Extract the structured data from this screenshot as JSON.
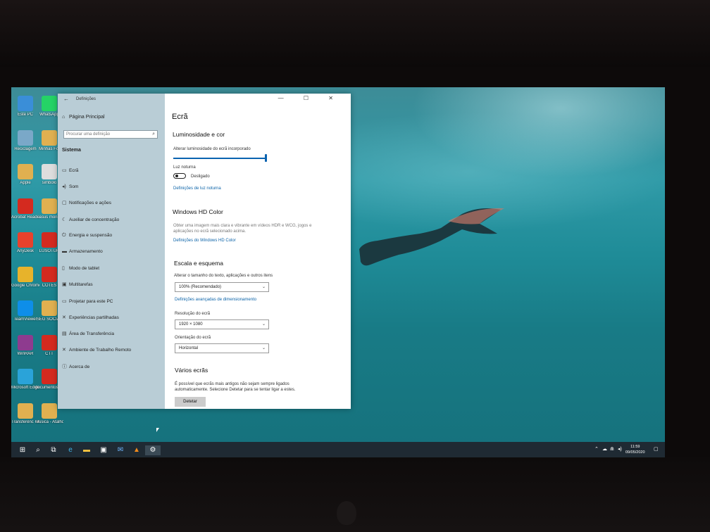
{
  "desktop": {
    "icons": [
      {
        "label": "Este PC",
        "color": "#3a8ed8"
      },
      {
        "label": "WhatsApp",
        "color": "#25d366"
      },
      {
        "label": "Reciclagem",
        "color": "#7aa8c8"
      },
      {
        "label": "Minhas Fot",
        "color": "#e0b050"
      },
      {
        "label": "Apple",
        "color": "#e0b050"
      },
      {
        "label": "simbolo",
        "color": "#ddd"
      },
      {
        "label": "Acrobat Reader DC",
        "color": "#d42a1f"
      },
      {
        "label": "asus monit",
        "color": "#e0b050"
      },
      {
        "label": "AnyDesk",
        "color": "#e8412c"
      },
      {
        "label": "LUSOTUR",
        "color": "#d42a1f"
      },
      {
        "label": "Google Chrome",
        "color": "#e7b32b"
      },
      {
        "label": "COTES",
        "color": "#d42a1f"
      },
      {
        "label": "TeamViewer",
        "color": "#0e8ee9"
      },
      {
        "label": "SEG SOCIAL",
        "color": "#e0b050"
      },
      {
        "label": "WinRAR",
        "color": "#8e3b8f"
      },
      {
        "label": "CTT",
        "color": "#d42a1f"
      },
      {
        "label": "Microsoft Edge",
        "color": "#2aa3d9"
      },
      {
        "label": "documentos carros",
        "color": "#d42a1f"
      },
      {
        "label": "Transferênc - Atalho",
        "color": "#e0b050"
      },
      {
        "label": "Musica - Atalho",
        "color": "#e0b050"
      }
    ]
  },
  "window": {
    "title": "Definições",
    "controls": "— ☐ ✕",
    "sidebar": {
      "home": "Página Principal",
      "search_placeholder": "Procurar uma definição",
      "heading": "Sistema",
      "items": [
        {
          "label": "Ecrã",
          "icon": "display-icon",
          "glyph": "▭"
        },
        {
          "label": "Som",
          "icon": "sound-icon",
          "glyph": "◂)"
        },
        {
          "label": "Notificações e ações",
          "icon": "notifications-icon",
          "glyph": "▢"
        },
        {
          "label": "Auxiliar de concentração",
          "icon": "focus-assist-icon",
          "glyph": "☾"
        },
        {
          "label": "Energia e suspensão",
          "icon": "power-icon",
          "glyph": "⏻"
        },
        {
          "label": "Armazenamento",
          "icon": "storage-icon",
          "glyph": "▬"
        },
        {
          "label": "Modo de tablet",
          "icon": "tablet-icon",
          "glyph": "▯"
        },
        {
          "label": "Multitarefas",
          "icon": "multitasking-icon",
          "glyph": "▣"
        },
        {
          "label": "Projetar para este PC",
          "icon": "project-icon",
          "glyph": "▭"
        },
        {
          "label": "Experiências partilhadas",
          "icon": "shared-experiences-icon",
          "glyph": "✕"
        },
        {
          "label": "Área de Transferência",
          "icon": "clipboard-icon",
          "glyph": "▤"
        },
        {
          "label": "Ambiente de Trabalho Remoto",
          "icon": "remote-desktop-icon",
          "glyph": "✕"
        },
        {
          "label": "Acerca de",
          "icon": "about-icon",
          "glyph": "ⓘ"
        }
      ]
    },
    "content": {
      "page_title": "Ecrã",
      "brightness_heading": "Luminosidade e cor",
      "brightness_label": "Alterar luminosidade do ecrã incorporado",
      "brightness_level": 1.0,
      "night_light_label": "Luz noturna",
      "night_light_state": "Desligado",
      "night_light_link": "Definições de luz noturna",
      "hd_heading": "Windows HD Color",
      "hd_desc_1": "Obter uma imagem mais clara e vibrante em vídeos HDR e WCG, jogos e",
      "hd_desc_2": "aplicações no ecrã selecionado acima.",
      "hd_link": "Definições do Windows HD Color",
      "scale_heading": "Escala e esquema",
      "scale_label": "Alterar o tamanho do texto, aplicações e outros itens",
      "scale_value": "100% (Recomendado)",
      "scale_link": "Definições avançadas de dimensionamento",
      "resolution_label": "Resolução do ecrã",
      "resolution_value": "1920 × 1080",
      "orientation_label": "Orientação do ecrã",
      "orientation_value": "Horizontal",
      "multi_heading": "Vários ecrãs",
      "multi_desc_1": "É possível que ecrãs mais antigos não sejam sempre ligados",
      "multi_desc_2": "automaticamente. Selecione Detetar para se tentar ligar a estes.",
      "detect_button": "Detetar"
    }
  },
  "taskbar": {
    "time": "11:59",
    "date": "09/05/2020"
  }
}
